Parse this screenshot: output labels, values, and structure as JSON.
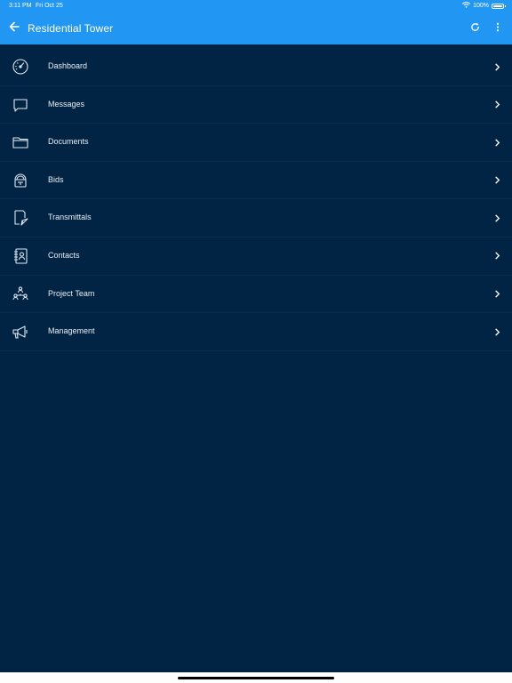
{
  "status_bar": {
    "time": "3:11 PM",
    "date": "Fri Oct 25",
    "battery": "100%",
    "icons": [
      "wifi-icon",
      "battery-icon"
    ]
  },
  "header": {
    "title": "Residential Tower",
    "back_icon": "arrow-left-icon",
    "refresh_icon": "refresh-icon",
    "more_icon": "more-vertical-icon"
  },
  "menu": {
    "items": [
      {
        "label": "Dashboard",
        "icon": "dashboard-gauge-icon"
      },
      {
        "label": "Messages",
        "icon": "message-bubble-icon"
      },
      {
        "label": "Documents",
        "icon": "folder-icon"
      },
      {
        "label": "Bids",
        "icon": "bids-icon"
      },
      {
        "label": "Transmittals",
        "icon": "transmittal-icon"
      },
      {
        "label": "Contacts",
        "icon": "contacts-book-icon"
      },
      {
        "label": "Project Team",
        "icon": "team-icon"
      },
      {
        "label": "Management",
        "icon": "megaphone-icon"
      }
    ]
  },
  "colors": {
    "header_bg": "#2196f3",
    "content_bg": "#022444",
    "text": "#e8eef5"
  }
}
